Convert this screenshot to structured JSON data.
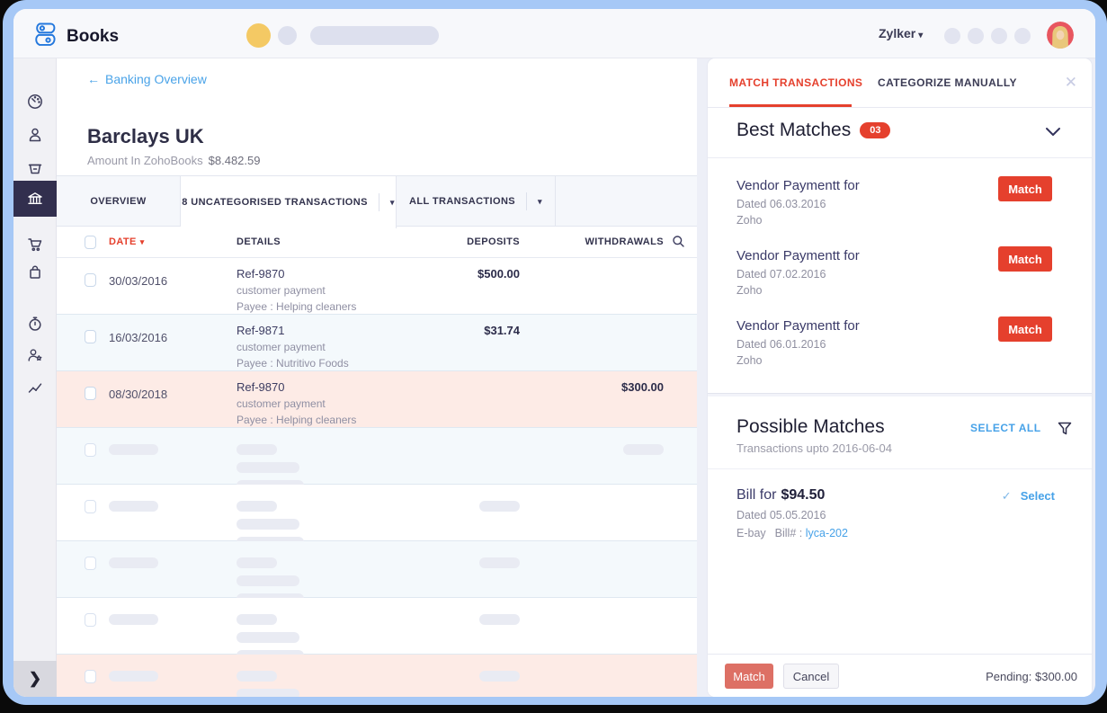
{
  "topbar": {
    "product": "Books",
    "org": "Zylker"
  },
  "icons": {
    "back_arrow": "←",
    "caret_down": "▾",
    "close": "✕",
    "check": "✓",
    "expand": "❯"
  },
  "sidebar": {
    "items": [
      "dashboard",
      "contacts",
      "items",
      "banking",
      "sales",
      "purchases",
      "time-tracking",
      "accountant",
      "reports"
    ],
    "active": "banking"
  },
  "main": {
    "back_link": "Banking Overview",
    "account": {
      "name": "Barclays UK",
      "amount_label": "Amount In ZohoBooks",
      "amount": "$8.482.59"
    },
    "tabs": {
      "overview": "OVERVIEW",
      "uncategorised": "8 UNCATEGORISED TRANSACTIONS",
      "all": "ALL TRANSACTIONS"
    },
    "table": {
      "headers": {
        "date": "DATE",
        "details": "DETAILS",
        "deposits": "DEPOSITS",
        "withdrawals": "WITHDRAWALS"
      },
      "rows": [
        {
          "date": "30/03/2016",
          "ref": "Ref-9870",
          "type": "customer payment",
          "payee": "Payee : Helping cleaners",
          "deposit": "$500.00",
          "withdrawal": ""
        },
        {
          "date": "16/03/2016",
          "ref": "Ref-9871",
          "type": "customer payment",
          "payee": "Payee : Nutritivo Foods",
          "deposit": "$31.74",
          "withdrawal": ""
        },
        {
          "date": "08/30/2018",
          "ref": "Ref-9870",
          "type": "customer payment",
          "payee": "Payee : Helping cleaners",
          "deposit": "",
          "withdrawal": "$300.00"
        }
      ]
    }
  },
  "panel": {
    "tabs": {
      "match": "MATCH TRANSACTIONS",
      "categorize": "CATEGORIZE MANUALLY"
    },
    "best_matches": {
      "title": "Best Matches",
      "count": "03",
      "items": [
        {
          "title": "Vendor Paymentt for",
          "dated": "Dated 06.03.2016",
          "vendor": "Zoho",
          "action": "Match"
        },
        {
          "title": "Vendor Paymentt for",
          "dated": "Dated 07.02.2016",
          "vendor": "Zoho",
          "action": "Match"
        },
        {
          "title": "Vendor Paymentt for",
          "dated": "Dated 06.01.2016",
          "vendor": "Zoho",
          "action": "Match"
        }
      ]
    },
    "possible_matches": {
      "title": "Possible Matches",
      "subtitle": "Transactions upto 2016-06-04",
      "select_all": "SELECT ALL",
      "items": [
        {
          "title": "Bill for",
          "amount": "$94.50",
          "dated": "Dated 05.05.2016",
          "vendor": "E-bay",
          "bill_label": "Bill# :",
          "bill_no": "lyca-202",
          "action": "Select"
        }
      ]
    },
    "footer": {
      "match": "Match",
      "cancel": "Cancel",
      "pending": "Pending: $300.00"
    }
  },
  "colors": {
    "accent_red": "#e5402d",
    "link_blue": "#47a2e8",
    "navy": "#322f4e",
    "frame_blue": "#a6c8f6"
  }
}
